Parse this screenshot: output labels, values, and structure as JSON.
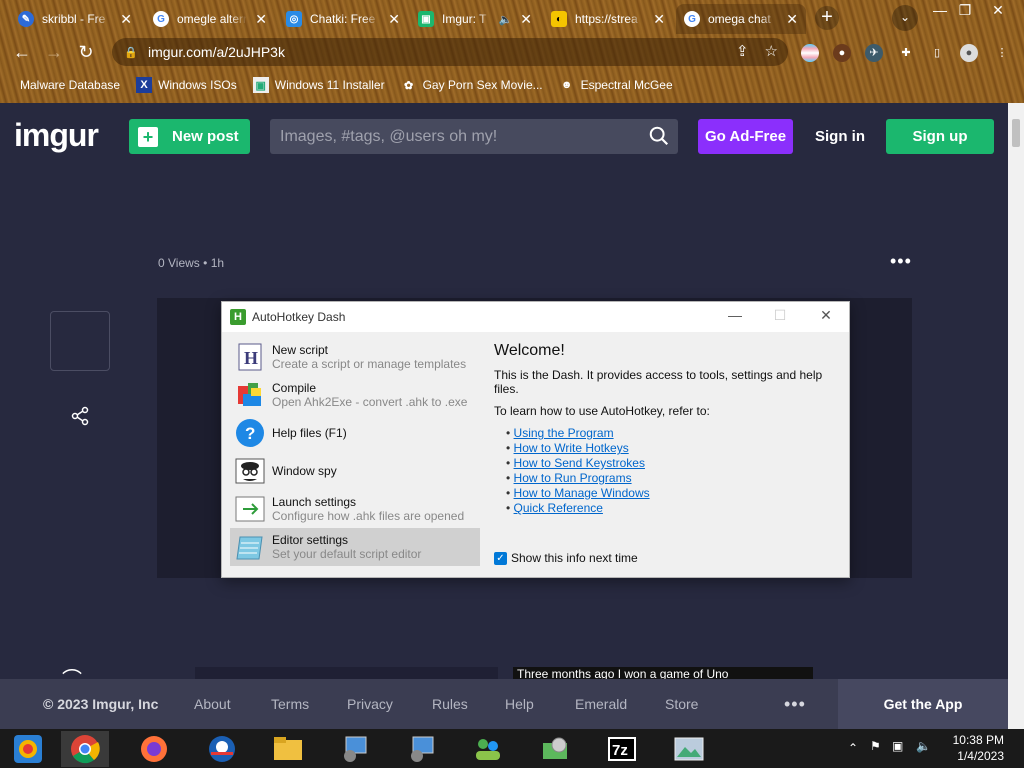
{
  "browser": {
    "tabs": [
      {
        "title": "skribbl - Fre",
        "icon": "skribbl-icon"
      },
      {
        "title": "omegle altern",
        "icon": "google-icon"
      },
      {
        "title": "Chatki: Free",
        "icon": "chatki-icon"
      },
      {
        "title": "Imgur: T",
        "icon": "imgur-icon"
      },
      {
        "title": "https://strea",
        "icon": "mask-icon"
      },
      {
        "title": "omega chat",
        "icon": "google-icon"
      }
    ],
    "url": "imgur.com/a/2uJHP3k",
    "bookmarks": [
      {
        "label": "Malware Database"
      },
      {
        "label": "Windows ISOs"
      },
      {
        "label": "Windows 11 Installer"
      },
      {
        "label": "Gay Porn Sex Movie..."
      },
      {
        "label": "Espectral McGee"
      }
    ]
  },
  "imgur": {
    "logo": "imgur",
    "new_post": "New post",
    "search_placeholder": "Images, #tags, @users oh my!",
    "ad_free": "Go Ad-Free",
    "sign_in": "Sign in",
    "sign_up": "Sign up",
    "views": "0 Views",
    "time": "1h",
    "caption": "Three months ago I won a game of Uno",
    "footer": {
      "copyright": "© 2023 Imgur, Inc",
      "links": [
        "About",
        "Terms",
        "Privacy",
        "Rules",
        "Help",
        "Emerald",
        "Store"
      ],
      "get_app": "Get the App"
    }
  },
  "dialog": {
    "title": "AutoHotkey Dash",
    "items": [
      {
        "title": "New script",
        "subtitle": "Create a script or manage templates"
      },
      {
        "title": "Compile",
        "subtitle": "Open Ahk2Exe - convert .ahk to .exe"
      },
      {
        "title": "Help files (F1)",
        "subtitle": ""
      },
      {
        "title": "Window spy",
        "subtitle": ""
      },
      {
        "title": "Launch settings",
        "subtitle": "Configure how .ahk files are opened"
      },
      {
        "title": "Editor settings",
        "subtitle": "Set your default script editor"
      }
    ],
    "welcome_title": "Welcome!",
    "welcome_text": "This is the Dash. It provides access to tools, settings and help files.",
    "learn_text": "To learn how to use AutoHotkey, refer to:",
    "links": [
      "Using the Program",
      "How to Write Hotkeys",
      "How to Send Keystrokes",
      "How to Run Programs",
      "How to Manage Windows",
      "Quick Reference"
    ],
    "show_info": "Show this info next time",
    "show_info_checked": true
  },
  "taskbar": {
    "time": "10:38 PM",
    "date": "1/4/2023"
  }
}
